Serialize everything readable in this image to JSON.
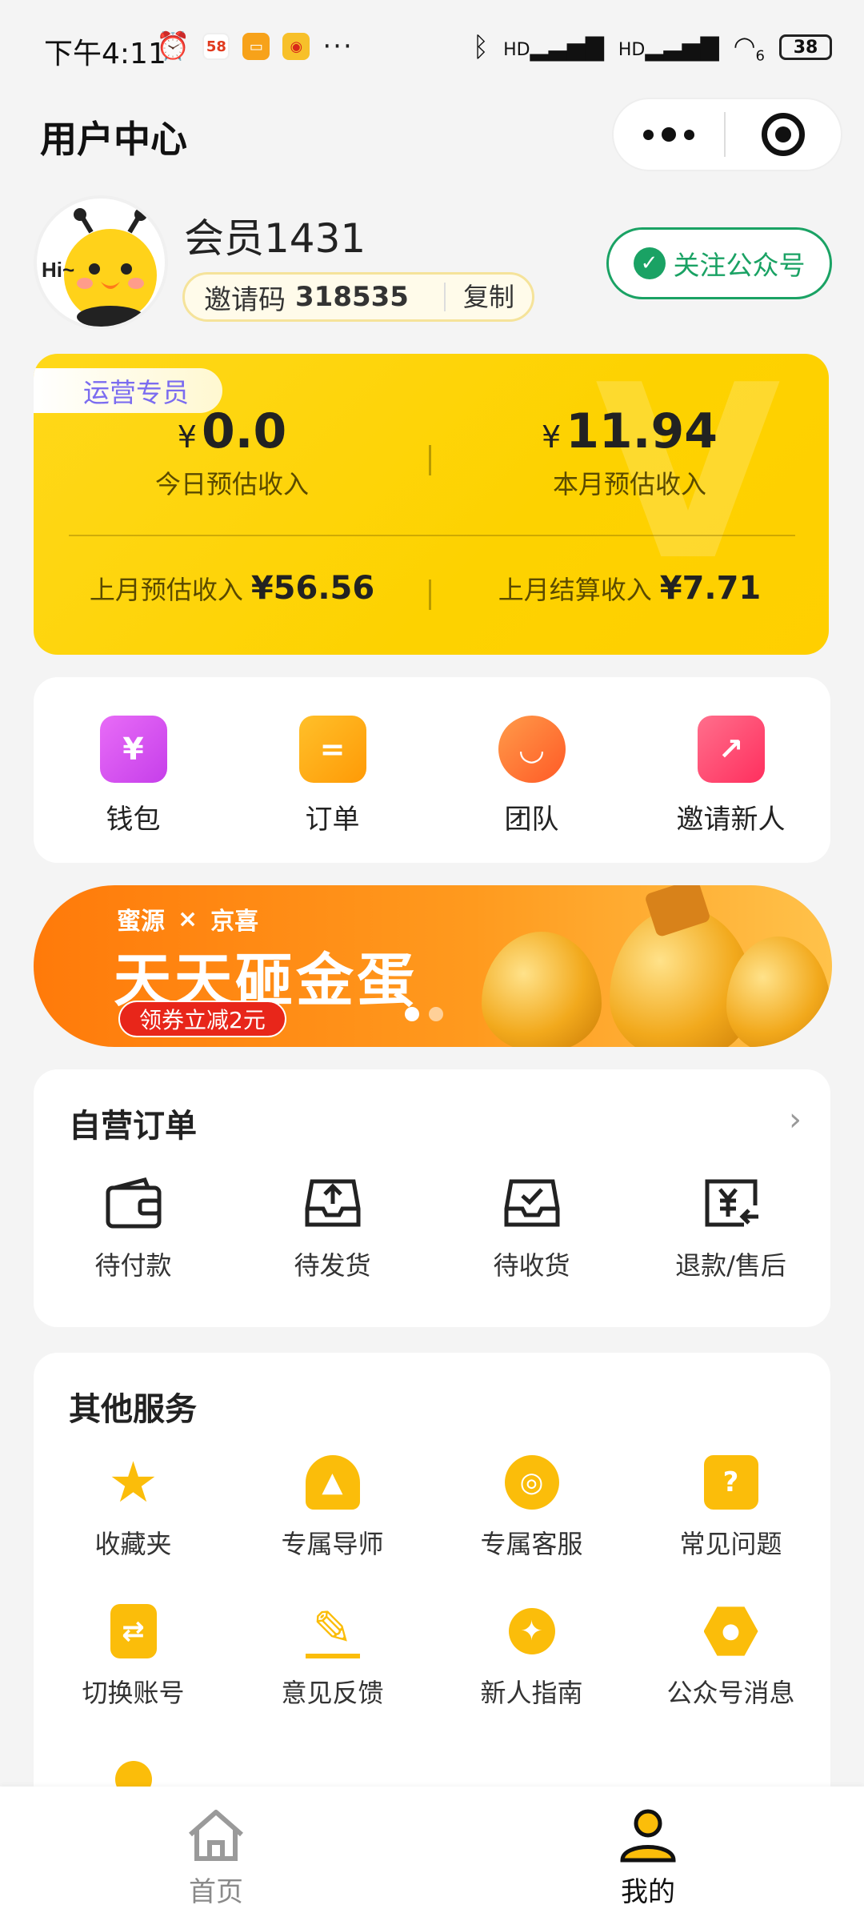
{
  "status_bar": {
    "time": "下午4:11",
    "mini_app_58": "58",
    "network_hd_1": "HD",
    "network_hd_2": "HD",
    "wifi_badge": "6",
    "battery": "38"
  },
  "header": {
    "title": "用户中心"
  },
  "profile": {
    "username": "会员1431",
    "invite_label": "邀请码",
    "invite_code": "318535",
    "copy_label": "复制",
    "follow_label": "关注公众号",
    "avatar_text": "Hi~"
  },
  "earnings": {
    "role_tag": "运营专员",
    "currency": "¥",
    "today_value": "0.0",
    "today_label": "今日预估收入",
    "month_value": "11.94",
    "month_label": "本月预估收入",
    "last_month_est_label": "上月预估收入",
    "last_month_est_value": "¥56.56",
    "last_month_settled_label": "上月结算收入",
    "last_month_settled_value": "¥7.71"
  },
  "quick_actions": [
    {
      "label": "钱包",
      "icon": "wallet-icon",
      "color": "#d94cf0",
      "glyph": "¥"
    },
    {
      "label": "订单",
      "icon": "order-icon",
      "color": "#ffa00a",
      "glyph": "="
    },
    {
      "label": "团队",
      "icon": "team-icon",
      "color": "#ff6a30",
      "glyph": "◡"
    },
    {
      "label": "邀请新人",
      "icon": "invite-icon",
      "color": "#ff3f6e",
      "glyph": "↗"
    }
  ],
  "banner": {
    "brand_a": "蜜源",
    "brand_x": "×",
    "brand_b": "京喜",
    "title": "天天砸金蛋",
    "coupon": "领券立减2元"
  },
  "self_orders": {
    "title": "自营订单",
    "items": [
      {
        "label": "待付款",
        "icon": "wallet-outline-icon"
      },
      {
        "label": "待发货",
        "icon": "outbox-icon"
      },
      {
        "label": "待收货",
        "icon": "inbox-check-icon"
      },
      {
        "label": "退款/售后",
        "icon": "refund-icon"
      }
    ]
  },
  "services": {
    "title": "其他服务",
    "items": [
      {
        "label": "收藏夹",
        "icon": "star-icon",
        "glyph": "★"
      },
      {
        "label": "专属导师",
        "icon": "graduation-cap-icon",
        "glyph": "▲"
      },
      {
        "label": "专属客服",
        "icon": "headset-icon",
        "glyph": "◎"
      },
      {
        "label": "常见问题",
        "icon": "question-icon",
        "glyph": "?"
      },
      {
        "label": "切换账号",
        "icon": "switch-account-icon",
        "glyph": "⇄"
      },
      {
        "label": "意见反馈",
        "icon": "pencil-icon",
        "glyph": "✎"
      },
      {
        "label": "新人指南",
        "icon": "compass-icon",
        "glyph": "✦"
      },
      {
        "label": "公众号消息",
        "icon": "hexagon-icon",
        "glyph": "●"
      }
    ]
  },
  "tabbar": {
    "home_label": "首页",
    "mine_label": "我的"
  },
  "colors": {
    "brand_yellow": "#fdd200",
    "accent_green": "#1aa264",
    "service_icon": "#fbbd0a"
  }
}
